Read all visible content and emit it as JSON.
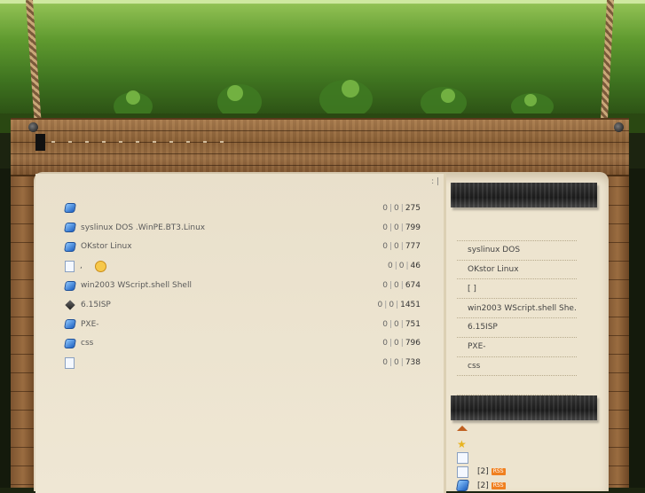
{
  "header": {
    "site_title": "",
    "subtitle": ""
  },
  "breadcrumb": ": |",
  "posts": [
    {
      "icon": "blue-post-icon",
      "title": "",
      "views": "0",
      "comments": "0",
      "hits": "275"
    },
    {
      "icon": "blue-post-icon",
      "title": "syslinux   DOS    .WinPE.BT3.Linux",
      "views": "0",
      "comments": "0",
      "hits": "799"
    },
    {
      "icon": "blue-post-icon",
      "title": "  OKstor Linux",
      "views": "0",
      "comments": "0",
      "hits": "777"
    },
    {
      "icon": "document-icon",
      "title": "             ,",
      "views": "0",
      "comments": "0",
      "hits": "46",
      "has_emoticon": true
    },
    {
      "icon": "blue-post-icon",
      "title": "win2003 WScript.shell Shell",
      "views": "0",
      "comments": "0",
      "hits": "674"
    },
    {
      "icon": "dark-diamond-icon",
      "title": "   6.15ISP",
      "views": "0",
      "comments": "0",
      "hits": "1451"
    },
    {
      "icon": "blue-post-icon",
      "title": "PXE-",
      "views": "0",
      "comments": "0",
      "hits": "751"
    },
    {
      "icon": "blue-post-icon",
      "title": "              css",
      "views": "0",
      "comments": "0",
      "hits": "796"
    },
    {
      "icon": "document-icon",
      "title": "",
      "views": "0",
      "comments": "0",
      "hits": "738"
    }
  ],
  "sidebar": {
    "recent_posts": [
      "",
      "syslinux   DOS",
      "  OKstor Linux",
      "[    ]",
      "win2003 WScript.shell She...",
      "   6.15ISP",
      "PXE-",
      "            css",
      ""
    ],
    "links": [
      {
        "icon": "home-icon",
        "label": "",
        "rss": ""
      },
      {
        "icon": "star-icon",
        "label": "",
        "rss": ""
      },
      {
        "icon": "document-icon",
        "label": "",
        "rss": ""
      },
      {
        "icon": "document-icon",
        "label": "[2]",
        "rss": "RSS"
      },
      {
        "icon": "blue-post-icon",
        "label": "[2]",
        "rss": "RSS"
      }
    ]
  },
  "colors": {
    "paper": "#ede4cf",
    "wood": "#8a6036",
    "grass": "#5f9a2f",
    "rss": "#f08020"
  }
}
